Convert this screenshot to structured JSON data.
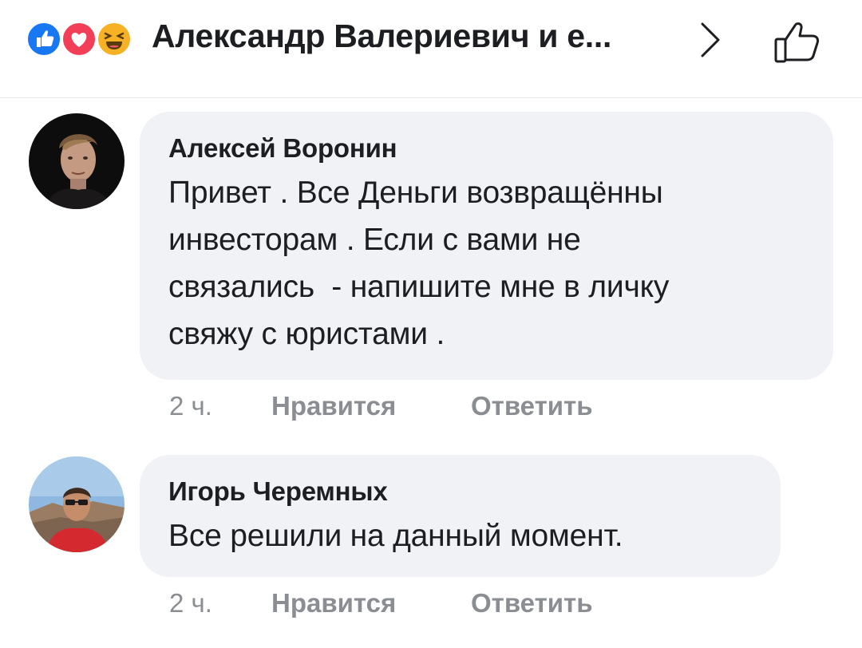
{
  "header": {
    "reactions": [
      {
        "type": "like",
        "icon": "thumbs-up-icon",
        "color": "#1877f2"
      },
      {
        "type": "love",
        "icon": "heart-icon",
        "color": "#f33e58"
      },
      {
        "type": "haha",
        "icon": "laughing-face-icon",
        "color": "#f7b125"
      }
    ],
    "title": "Александр Валериевич и е...",
    "chevron_icon": "chevron-right-icon",
    "like_icon": "thumbs-up-outline-icon"
  },
  "comments": [
    {
      "author": "Алексей Воронин",
      "text": "Привет . Все Деньги возвращённы\nинвесторам . Если с вами не\nсвязались  - напишите мне в личку\nсвяжу с юристами .",
      "time": "2 ч.",
      "like_label": "Нравится",
      "reply_label": "Ответить"
    },
    {
      "author": "Игорь Черемных",
      "text": "Все решили на данный момент.",
      "time": "2 ч.",
      "like_label": "Нравится",
      "reply_label": "Ответить"
    }
  ],
  "colors": {
    "bubble": "#f0f2f5",
    "meta_text": "#8a8d91",
    "primary_text": "#1c1e21"
  }
}
